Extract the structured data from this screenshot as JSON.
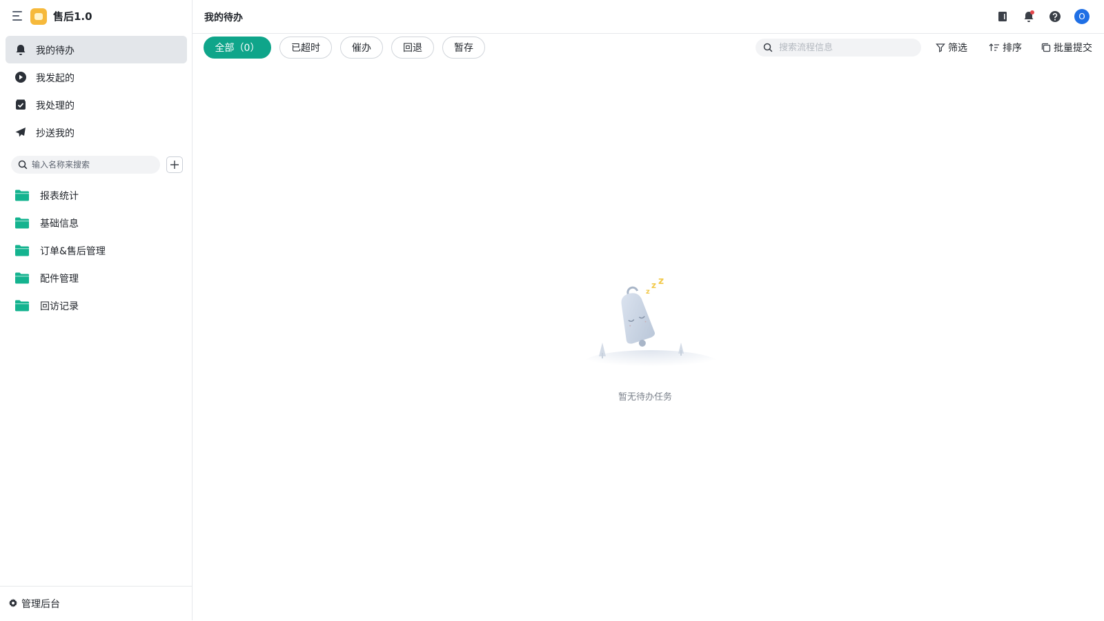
{
  "app": {
    "title": "售后1.0"
  },
  "sidebar": {
    "nav": [
      {
        "label": "我的待办",
        "icon": "bell-icon",
        "active": true
      },
      {
        "label": "我发起的",
        "icon": "play-circle-icon",
        "active": false
      },
      {
        "label": "我处理的",
        "icon": "check-box-icon",
        "active": false
      },
      {
        "label": "抄送我的",
        "icon": "send-icon",
        "active": false
      }
    ],
    "search": {
      "placeholder": "输入名称来搜索"
    },
    "folders": [
      {
        "label": "报表统计",
        "icon": "folder-icon"
      },
      {
        "label": "基础信息",
        "icon": "folder-icon"
      },
      {
        "label": "订单&售后管理",
        "icon": "folder-icon"
      },
      {
        "label": "配件管理",
        "icon": "folder-icon"
      },
      {
        "label": "回访记录",
        "icon": "folder-icon"
      }
    ],
    "admin": {
      "label": "管理后台",
      "icon": "gear-icon"
    }
  },
  "header": {
    "title": "我的待办",
    "icons": [
      "notebook-icon",
      "bell-notification-icon",
      "help-icon"
    ],
    "avatar_initial": "O",
    "notification_dot_color": "#e5484d"
  },
  "tabs": [
    {
      "label": "全部（0）",
      "active": true
    },
    {
      "label": "已超时",
      "active": false
    },
    {
      "label": "催办",
      "active": false
    },
    {
      "label": "回退",
      "active": false
    },
    {
      "label": "暂存",
      "active": false
    }
  ],
  "toolbar": {
    "search_placeholder": "搜索流程信息",
    "filter_label": "筛选",
    "sort_label": "排序",
    "batch_label": "批量提交"
  },
  "empty_state": {
    "text": "暂无待办任务",
    "illustration": "sleeping-bell-icon"
  },
  "colors": {
    "accent": "#0fa58a",
    "folder": "#14b38f",
    "logo": "#f6b93b",
    "avatar": "#1f6fe5"
  }
}
